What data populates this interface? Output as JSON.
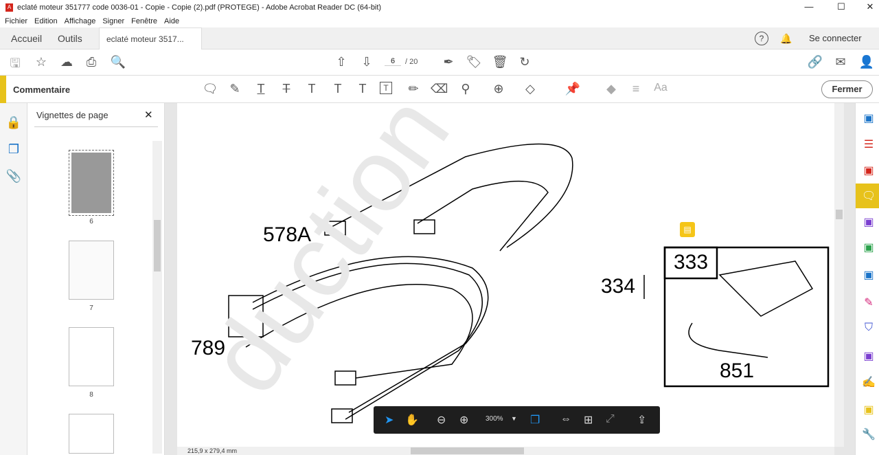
{
  "window": {
    "title": "eclaté moteur 351777 code 0036-01 - Copie - Copie (2).pdf (PROTEGE) - Adobe Acrobat Reader DC (64-bit)",
    "minimize": "—",
    "maximize": "☐",
    "close": "✕"
  },
  "menu": [
    "Fichier",
    "Edition",
    "Affichage",
    "Signer",
    "Fenêtre",
    "Aide"
  ],
  "tabs": {
    "home": "Accueil",
    "tools": "Outils",
    "doc": "eclaté moteur 3517...",
    "close": "×",
    "help": "?",
    "signin": "Se connecter"
  },
  "toolbar": {
    "page_current": "6",
    "page_total": "/ 20"
  },
  "comment": {
    "title": "Commentaire",
    "close": "Fermer",
    "font_size_icon": "Aa"
  },
  "thumbnails": {
    "title": "Vignettes de page",
    "close": "✕",
    "pages": [
      "6",
      "7",
      "8"
    ]
  },
  "document": {
    "labels": [
      "578A",
      "789",
      "334",
      "333",
      "851"
    ],
    "watermark": "duction",
    "page_size": "215,9 x 279,4 mm"
  },
  "floating": {
    "zoom": "300%"
  },
  "colors": {
    "accent": "#e7c21b",
    "blue": "#2196f3"
  }
}
